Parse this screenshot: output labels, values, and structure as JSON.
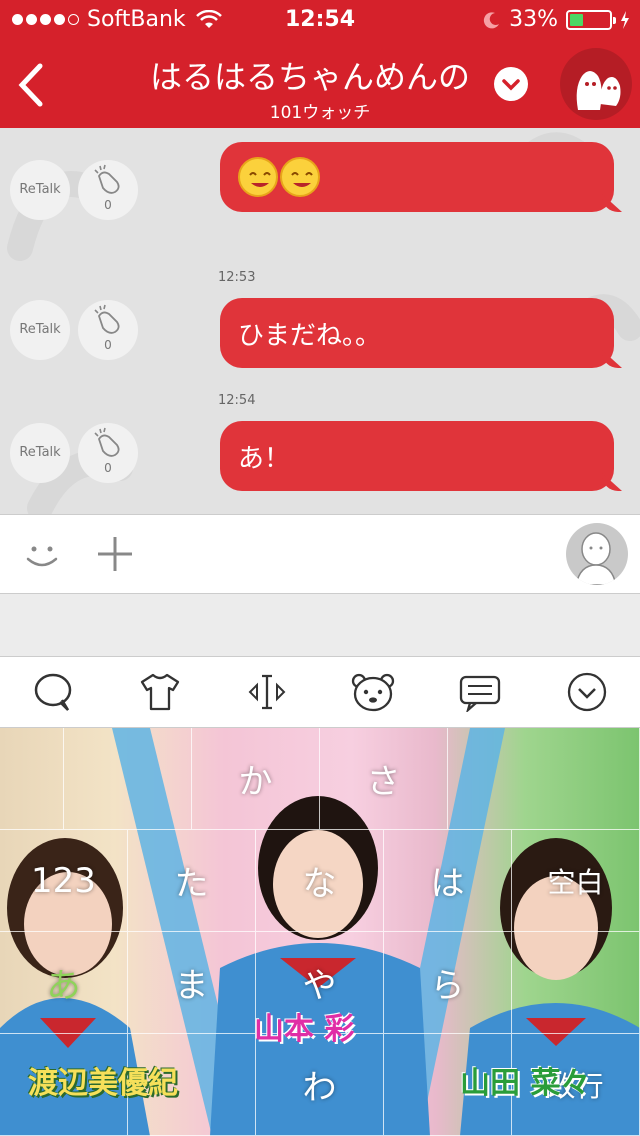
{
  "status_bar": {
    "carrier": "SoftBank",
    "time": "12:54",
    "battery": "33%",
    "battery_level": 0.33
  },
  "header": {
    "title": "はるはるちゃんめんの",
    "subtitle": "101ウォッチ"
  },
  "messages": [
    {
      "text": "",
      "emoji_count": 2,
      "retalk": "ReTalk",
      "claps": "0"
    },
    {
      "time": "12:53",
      "text": "ひまだね。。",
      "retalk": "ReTalk",
      "claps": "0"
    },
    {
      "time": "12:54",
      "text": "あ！",
      "retalk": "ReTalk",
      "claps": "0"
    }
  ],
  "keyboard": {
    "toolbar_icons": [
      "speech-bubble-icon",
      "tshirt-icon",
      "cursor-icon",
      "bear-face-icon",
      "message-icon",
      "chevron-down-icon"
    ],
    "keys": {
      "k1": "か",
      "k2": "さ",
      "k3": "123",
      "k4": "た",
      "k5": "な",
      "k6": "は",
      "k7": "空白",
      "k8": "あ",
      "k9": "ま",
      "k10": "や",
      "k11": "ら",
      "k12": "わ",
      "k13": "改行"
    },
    "names": {
      "left": "渡辺美優紀",
      "center": "山本 彩",
      "right": "山田 菜々"
    }
  },
  "colors": {
    "header": "#d5212b",
    "bubble": "#e0343a",
    "chat_bg": "#e2e2e2"
  }
}
